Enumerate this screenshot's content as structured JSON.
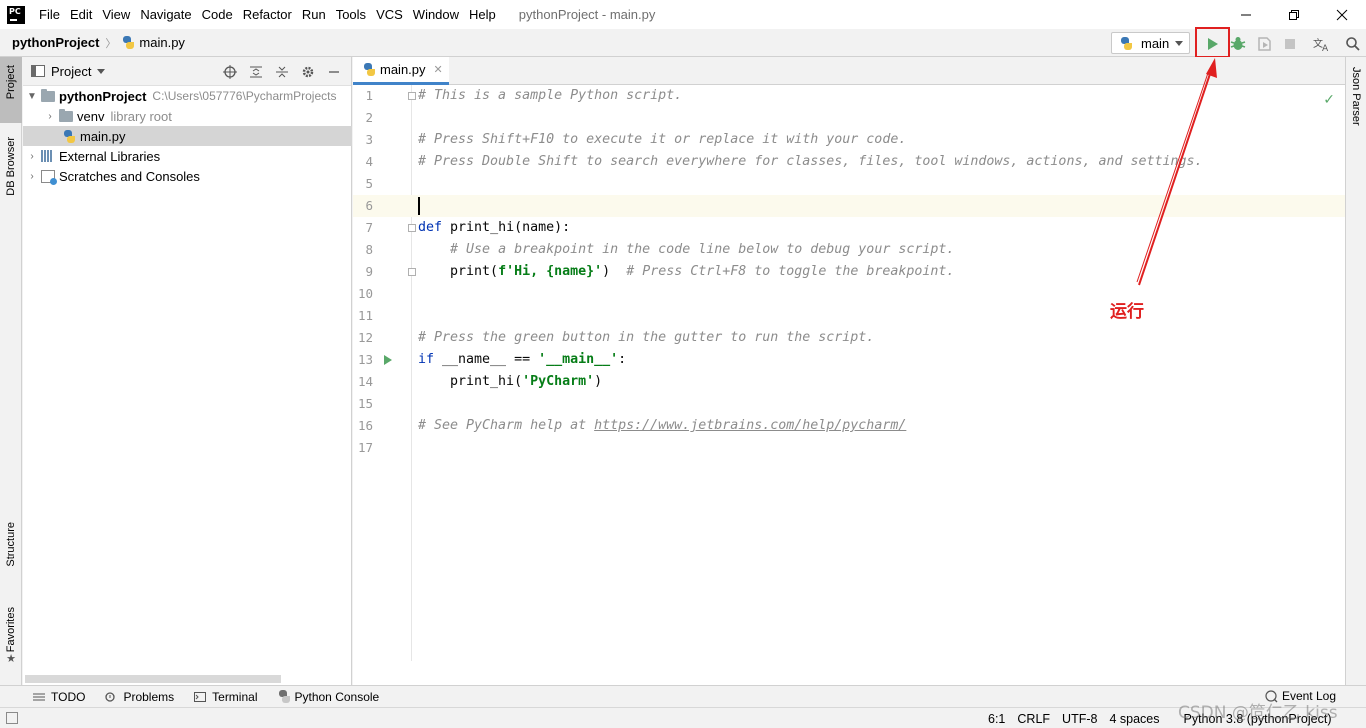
{
  "app": {
    "logo_text": "PC",
    "window_title": "pythonProject - main.py",
    "menu": [
      "File",
      "Edit",
      "View",
      "Navigate",
      "Code",
      "Refactor",
      "Run",
      "Tools",
      "VCS",
      "Window",
      "Help"
    ]
  },
  "navbar": {
    "project": "pythonProject",
    "file": "main.py",
    "run_config": "main"
  },
  "left_strip": {
    "project_tab": "Project",
    "db_browser_tab": "DB Browser",
    "structure_tab": "Structure",
    "favorites_tab": "Favorites"
  },
  "right_strip": {
    "json_parser_tab": "Json Parser"
  },
  "project_panel": {
    "title": "Project",
    "tree": {
      "root_name": "pythonProject",
      "root_path": "C:\\Users\\057776\\PycharmProjects",
      "venv_name": "venv",
      "venv_hint": "library root",
      "main_file": "main.py",
      "external_libraries": "External Libraries",
      "scratches": "Scratches and Consoles"
    }
  },
  "editor": {
    "tab_label": "main.py",
    "current_line": 6,
    "run_gutter_line": 13,
    "lines": [
      "# This is a sample Python script.",
      "",
      "# Press Shift+F10 to execute it or replace it with your code.",
      "# Press Double Shift to search everywhere for classes, files, tool windows, actions, and settings.",
      "",
      "",
      "def print_hi(name):",
      "    # Use a breakpoint in the code line below to debug your script.",
      "    print(f'Hi, {name}')  # Press Ctrl+F8 to toggle the breakpoint.",
      "",
      "",
      "# Press the green button in the gutter to run the script.",
      "if __name__ == '__main__':",
      "    print_hi('PyCharm')",
      "",
      "# See PyCharm help at https://www.jetbrains.com/help/pycharm/",
      ""
    ],
    "line_numbers": [
      "1",
      "2",
      "3",
      "4",
      "5",
      "6",
      "7",
      "8",
      "9",
      "10",
      "11",
      "12",
      "13",
      "14",
      "15",
      "16",
      "17"
    ]
  },
  "annotation": {
    "label": "运行",
    "color": "#e02020"
  },
  "bottom_tabs": {
    "todo": "TODO",
    "problems": "Problems",
    "terminal": "Terminal",
    "python_console": "Python Console",
    "event_log": "Event Log"
  },
  "status": {
    "position": "6:1",
    "line_sep": "CRLF",
    "encoding": "UTF-8",
    "indent": "4 spaces",
    "interpreter": "Python 3.8 (pythonProject)"
  },
  "watermark": "CSDN @笸仁乙 kiss",
  "colors": {
    "run_green": "#59a869",
    "debug_green": "#59a869",
    "highlight_red": "#e02020",
    "tab_underline": "#4083c9"
  }
}
